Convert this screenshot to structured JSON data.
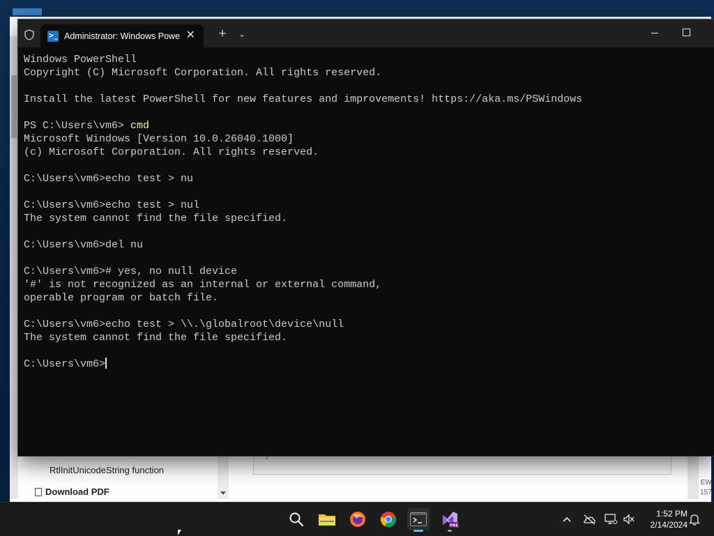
{
  "background_app": {
    "nav_item": "RtlInitUnicodeString function",
    "download_label": "Download PDF",
    "code_fragment": "}",
    "right_fragment_1": "EW",
    "right_fragment_2": "157"
  },
  "terminal": {
    "tab_title": "Administrator: Windows PowerShell",
    "new_tab_glyph": "+",
    "dropdown_glyph": "⌄",
    "close_glyph": "✕",
    "lines": [
      {
        "text": "Windows PowerShell",
        "cmd": ""
      },
      {
        "text": "Copyright (C) Microsoft Corporation. All rights reserved.",
        "cmd": ""
      },
      {
        "text": "",
        "cmd": ""
      },
      {
        "text": "Install the latest PowerShell for new features and improvements! https://aka.ms/PSWindows",
        "cmd": ""
      },
      {
        "text": "",
        "cmd": ""
      },
      {
        "text": "PS C:\\Users\\vm6> ",
        "cmd": "cmd"
      },
      {
        "text": "Microsoft Windows [Version 10.0.26040.1000]",
        "cmd": ""
      },
      {
        "text": "(c) Microsoft Corporation. All rights reserved.",
        "cmd": ""
      },
      {
        "text": "",
        "cmd": ""
      },
      {
        "text": "C:\\Users\\vm6>echo test > nu",
        "cmd": ""
      },
      {
        "text": "",
        "cmd": ""
      },
      {
        "text": "C:\\Users\\vm6>echo test > nul",
        "cmd": ""
      },
      {
        "text": "The system cannot find the file specified.",
        "cmd": ""
      },
      {
        "text": "",
        "cmd": ""
      },
      {
        "text": "C:\\Users\\vm6>del nu",
        "cmd": ""
      },
      {
        "text": "",
        "cmd": ""
      },
      {
        "text": "C:\\Users\\vm6># yes, no null device",
        "cmd": ""
      },
      {
        "text": "'#' is not recognized as an internal or external command,",
        "cmd": ""
      },
      {
        "text": "operable program or batch file.",
        "cmd": ""
      },
      {
        "text": "",
        "cmd": ""
      },
      {
        "text": "C:\\Users\\vm6>echo test > \\\\.\\globalroot\\device\\null",
        "cmd": ""
      },
      {
        "text": "The system cannot find the file specified.",
        "cmd": ""
      },
      {
        "text": "",
        "cmd": ""
      }
    ],
    "prompt": "C:\\Users\\vm6>",
    "colors": {
      "background": "#0c0c0c",
      "foreground": "#cccccc",
      "command": "#f9f1a5",
      "titlebar": "#202020"
    }
  },
  "taskbar": {
    "apps": [
      {
        "name": "search-icon"
      },
      {
        "name": "file-explorer-icon"
      },
      {
        "name": "firefox-icon"
      },
      {
        "name": "chrome-icon"
      },
      {
        "name": "terminal-icon",
        "active": true
      },
      {
        "name": "visual-studio-icon",
        "badge": "PRE"
      }
    ],
    "tray_icons": [
      "chevron-up-icon",
      "onedrive-offline-icon",
      "network-icon",
      "volume-muted-icon",
      "notification-bell-icon"
    ],
    "time": "1:52 PM",
    "date": "2/14/2024"
  }
}
